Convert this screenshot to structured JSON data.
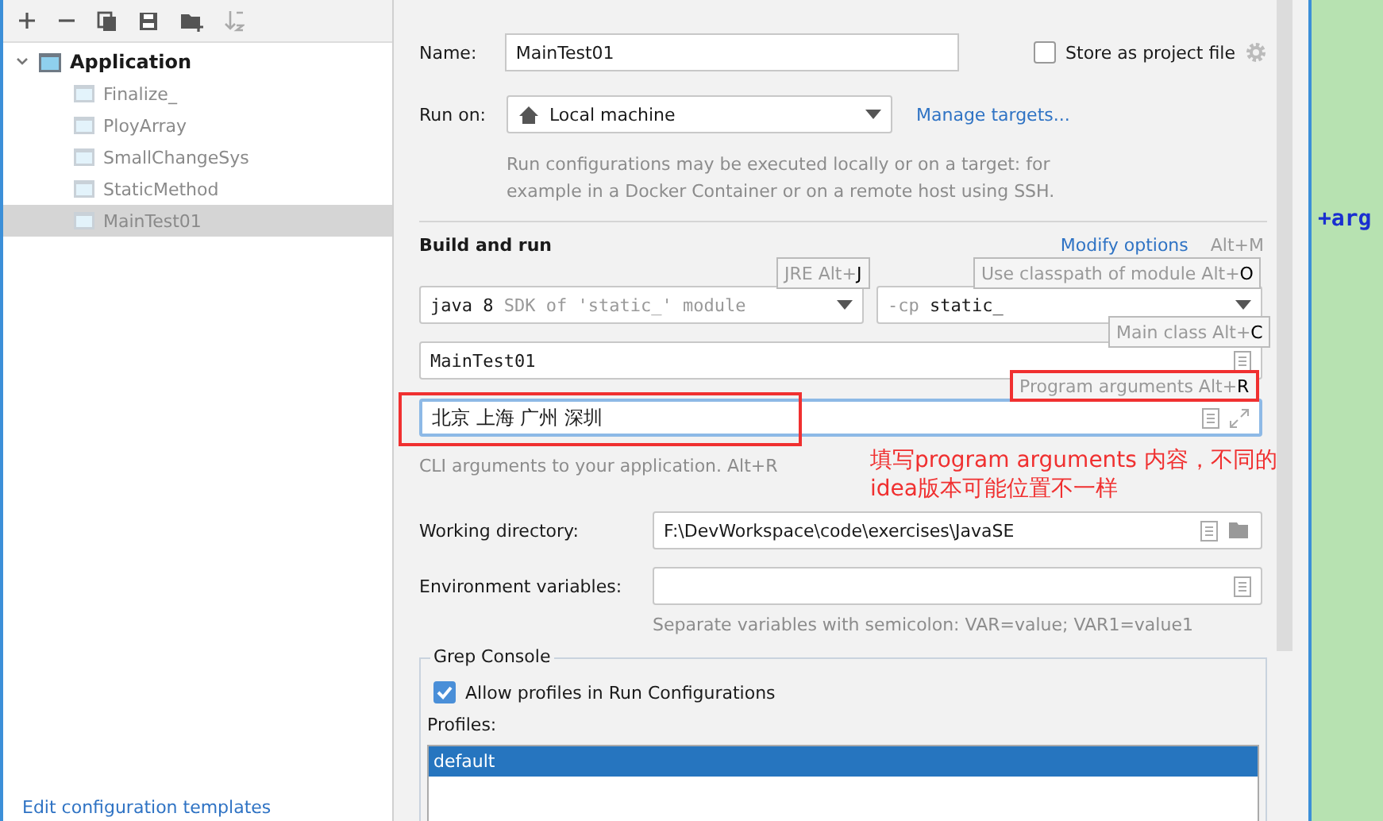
{
  "tree": {
    "label": "Application",
    "expanded": true,
    "children": [
      {
        "label": "Finalize_",
        "selected": false
      },
      {
        "label": "PloyArray",
        "selected": false
      },
      {
        "label": "SmallChangeSys",
        "selected": false
      },
      {
        "label": "StaticMethod",
        "selected": false
      },
      {
        "label": "MainTest01",
        "selected": true
      }
    ]
  },
  "edit_templates_link": "Edit configuration templates",
  "form": {
    "name": {
      "label": "Name:",
      "value": "MainTest01"
    },
    "store_as_project_file": {
      "label": "Store as project file",
      "checked": false
    },
    "run_on": {
      "label": "Run on:",
      "value": "Local machine",
      "link": "Manage targets..."
    },
    "run_on_hint": "Run configurations may be executed locally or on a target: for example in a Docker Container or on a remote host using SSH.",
    "build_and_run": {
      "title": "Build and run",
      "modify_options": "Modify options",
      "modify_shortcut": "Alt+M",
      "jre": {
        "value": "java 8",
        "detail": "SDK of 'static_' module"
      },
      "classpath": {
        "prefix": "-cp",
        "value": "static_"
      },
      "main_class": "MainTest01",
      "program_arguments": "北京  上海  广州  深圳",
      "arguments_hint": "CLI arguments to your application. Alt+R",
      "hints": [
        {
          "text": "JRE Alt+",
          "key": "J",
          "highlighted": false
        },
        {
          "text": "Use classpath of module Alt+",
          "key": "O",
          "highlighted": false
        },
        {
          "text": "Main class Alt+",
          "key": "C",
          "highlighted": false
        },
        {
          "text": "Program arguments Alt+",
          "key": "R",
          "highlighted": true
        }
      ]
    },
    "working_directory": {
      "label": "Working directory:",
      "value": "F:\\DevWorkspace\\code\\exercises\\JavaSE"
    },
    "environment_variables": {
      "label": "Environment variables:",
      "hint": "Separate variables with semicolon: VAR=value; VAR1=value1"
    },
    "grep_console": {
      "title": "Grep Console",
      "allow_profiles": {
        "label": "Allow profiles in Run Configurations",
        "checked": true
      },
      "profiles_label": "Profiles:",
      "profiles": [
        {
          "label": "default",
          "selected": true
        }
      ]
    }
  },
  "annotation": {
    "lines": [
      "填写program arguments 内容，不同的",
      "idea版本可能位置不一样"
    ]
  },
  "editor": {
    "text": "+arg"
  }
}
